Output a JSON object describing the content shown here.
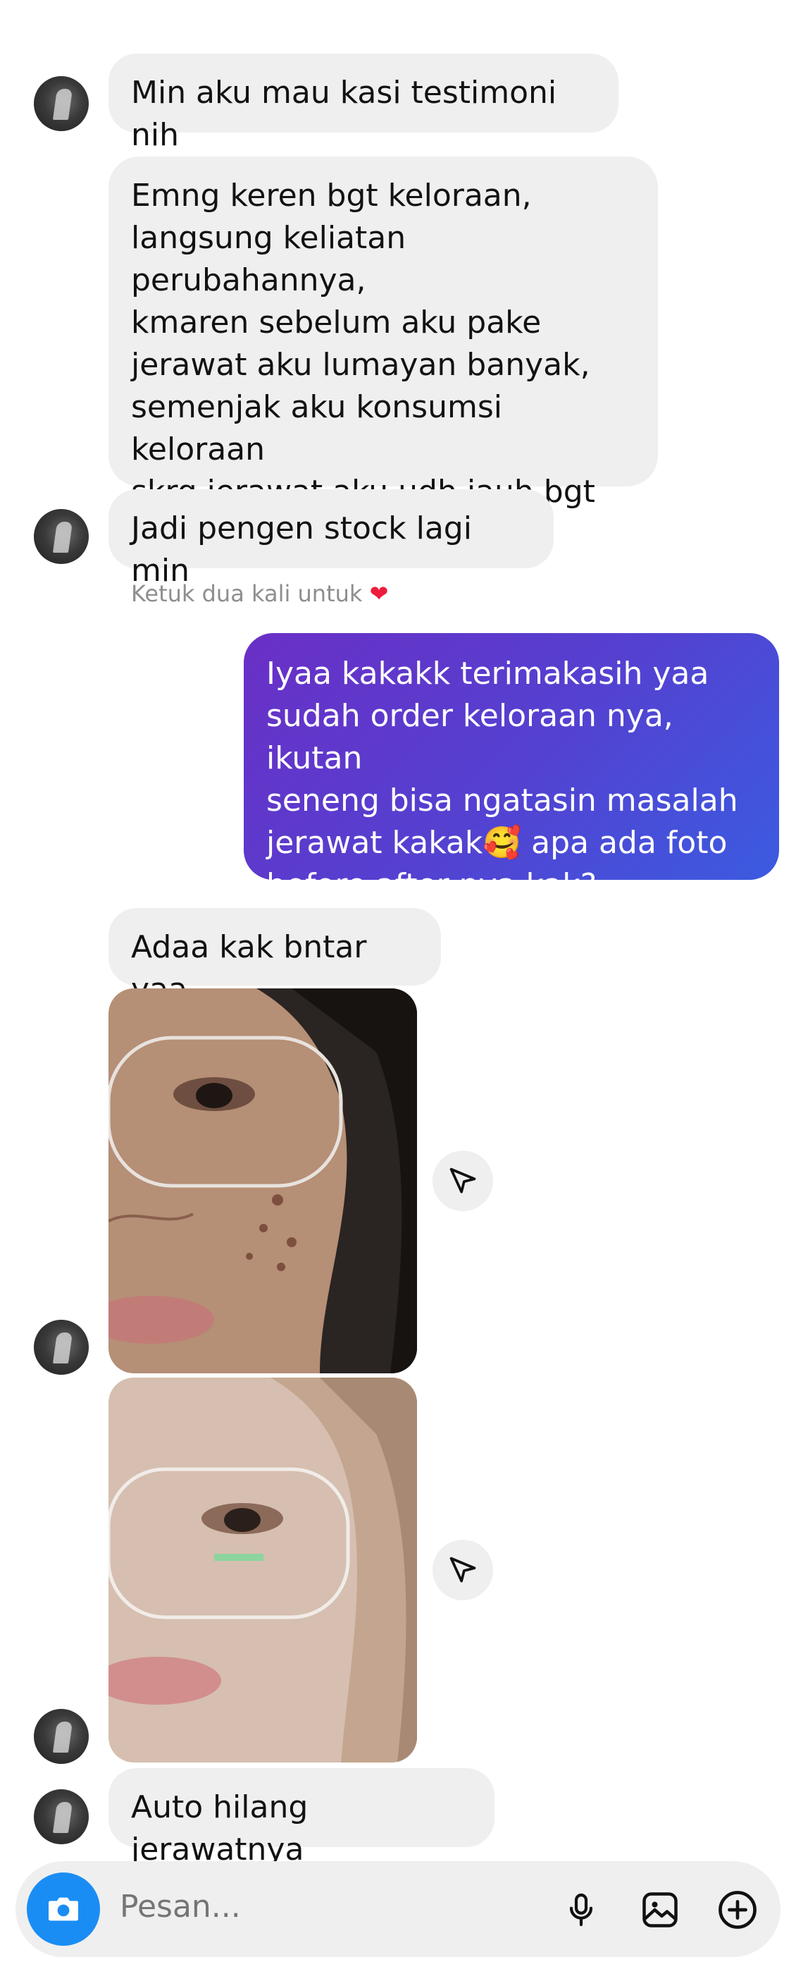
{
  "messages": {
    "m1": "Min aku mau kasi testimoni nih",
    "m2": "Emng keren bgt keloraan,\nlangsung keliatan perubahannya,\nkmaren sebelum aku pake\njerawat aku lumayan banyak,\nsemenjak aku konsumsi keloraan\nskrg jerawat aku udh jauh bgt\nberkurangnyaa",
    "m3": "Jadi pengen stock lagi min",
    "reply": "Iyaa kakakk terimakasih yaa\nsudah order keloraan nya, ikutan\nseneng bisa ngatasin masalah\njerawat kakak🥰 apa ada foto\nbefore after nya kak?",
    "m4": "Adaa kak bntar yaa",
    "m5": "Auto hilang jerawatnya"
  },
  "hint": {
    "text": "Ketuk dua kali untuk",
    "heart": "❤"
  },
  "composer": {
    "placeholder": "Pesan..."
  },
  "icons": {
    "camera": "camera-icon",
    "mic": "microphone-icon",
    "gallery": "gallery-icon",
    "plus": "add-circle-icon",
    "share": "send-icon"
  },
  "colors": {
    "incoming_bubble": "#efefef",
    "outgoing_start": "#6a2fc6",
    "outgoing_end": "#3b5be0",
    "camera_button": "#1a8df4",
    "heart": "#ed1c3c"
  }
}
